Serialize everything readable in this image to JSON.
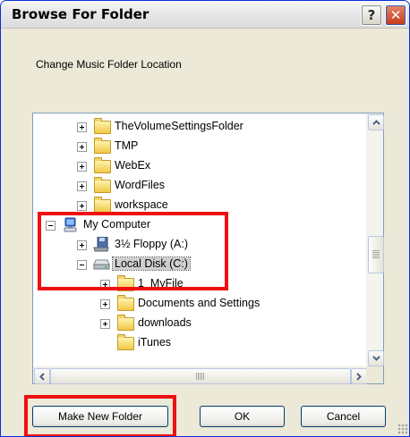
{
  "window": {
    "title": "Browse For Folder",
    "help_label": "?",
    "close_label": "✕"
  },
  "instruction": "Change Music Folder Location",
  "tree": {
    "items": [
      {
        "label": "TheVolumeSettingsFolder",
        "icon": "folder-icon",
        "expander": "plus"
      },
      {
        "label": "TMP",
        "icon": "folder-icon",
        "expander": "plus"
      },
      {
        "label": "WebEx",
        "icon": "folder-icon",
        "expander": "plus"
      },
      {
        "label": "WordFiles",
        "icon": "folder-icon",
        "expander": "plus"
      },
      {
        "label": "workspace",
        "icon": "folder-icon",
        "expander": "plus"
      },
      {
        "label": "My Computer",
        "icon": "computer-icon",
        "expander": "minus"
      },
      {
        "label": "3½ Floppy (A:)",
        "icon": "floppy-icon",
        "expander": "plus"
      },
      {
        "label": "Local Disk (C:)",
        "icon": "disk-icon",
        "expander": "minus",
        "selected": true
      },
      {
        "label": "1_MyFile",
        "icon": "folder-icon",
        "expander": "plus"
      },
      {
        "label": "Documents and Settings",
        "icon": "folder-icon",
        "expander": "plus"
      },
      {
        "label": "downloads",
        "icon": "folder-icon",
        "expander": "plus"
      },
      {
        "label": "iTunes",
        "icon": "folder-icon",
        "expander": "none"
      }
    ]
  },
  "buttons": {
    "make_new_folder": "Make New Folder",
    "ok": "OK",
    "cancel": "Cancel"
  },
  "colors": {
    "highlight": "#ee1111",
    "dialog_bg": "#ece9d8",
    "selection": "#cfcfcf"
  }
}
